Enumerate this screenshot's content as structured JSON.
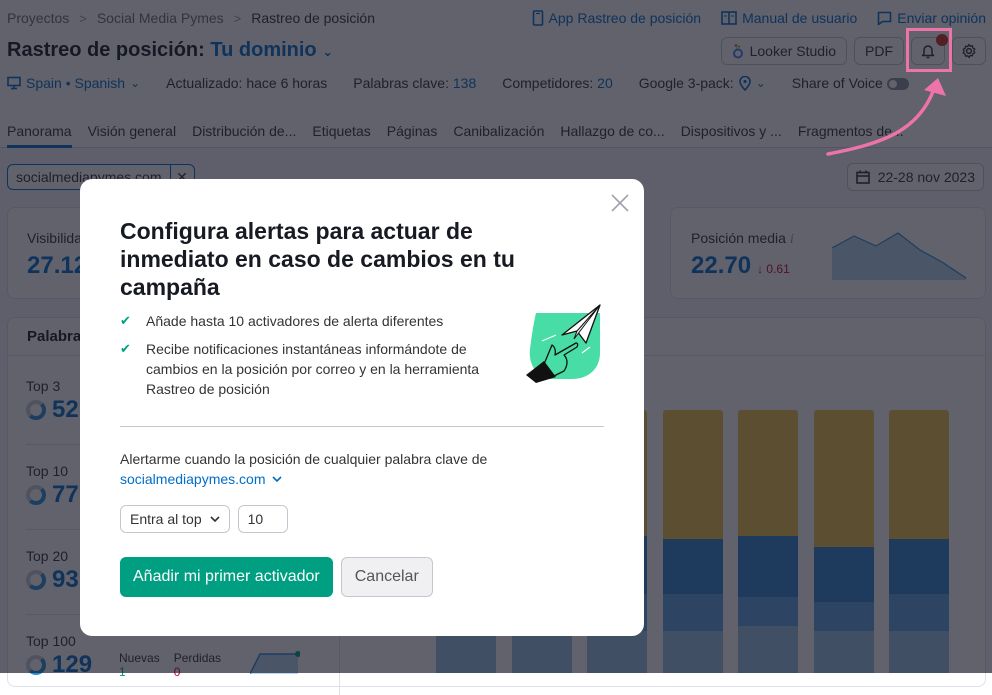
{
  "breadcrumb": [
    "Proyectos",
    "Social Media Pymes",
    "Rastreo de posición"
  ],
  "header_links": [
    {
      "label": "App Rastreo de posición",
      "icon": "mobile-icon"
    },
    {
      "label": "Manual de usuario",
      "icon": "book-icon"
    },
    {
      "label": "Enviar opinión",
      "icon": "comment-icon"
    }
  ],
  "title": {
    "prefix": "Rastreo de posición:",
    "domain": "Tu dominio"
  },
  "toolbar": {
    "looker_label": "Looker Studio",
    "pdf_label": "PDF",
    "bell_has_notification": true
  },
  "meta": {
    "location": "Spain • Spanish",
    "updated": "Actualizado: hace 6 horas",
    "keywords_label": "Palabras clave:",
    "keywords_value": "138",
    "competitors_label": "Competidores:",
    "competitors_value": "20",
    "google_pack_label": "Google 3-pack:",
    "share_of_voice_label": "Share of Voice",
    "share_of_voice_on": false
  },
  "tabs": [
    "Panorama",
    "Visión general",
    "Distribución de...",
    "Etiquetas",
    "Páginas",
    "Canibalización",
    "Hallazgo de co...",
    "Dispositivos y ...",
    "Fragmentos de..."
  ],
  "active_tab": "Panorama",
  "filter_chip": "socialmediapymes.com",
  "date_range": "22-28 nov 2023",
  "kpis": {
    "visibility": {
      "label": "Visibilidad",
      "value": "27.12"
    },
    "avg_position": {
      "label": "Posición media",
      "value": "22.70",
      "delta": "↓ 0.61"
    }
  },
  "keywords_card": {
    "title": "Palabras",
    "rows": [
      {
        "label": "Top 3",
        "value": "52"
      },
      {
        "label": "Top 10",
        "value": "77"
      },
      {
        "label": "Top 20",
        "value": "93"
      },
      {
        "label": "Top 100",
        "value": "129"
      }
    ],
    "new_label": "Nuevas",
    "new_value": "1",
    "lost_label": "Perdidas",
    "lost_value": "0"
  },
  "chart_data": {
    "type": "bar",
    "stacked": true,
    "series_colors": [
      "#9cc3ea",
      "#5fa4e0",
      "#2f86d4",
      "#f0c04a"
    ],
    "series": [
      {
        "name": "Top 100",
        "values": [
          0.16,
          0.16,
          0.16,
          0.16,
          0.18,
          0.16,
          0.16
        ]
      },
      {
        "name": "Top 20",
        "values": [
          0.14,
          0.14,
          0.14,
          0.14,
          0.11,
          0.11,
          0.14
        ]
      },
      {
        "name": "Top 10",
        "values": [
          0.22,
          0.22,
          0.22,
          0.21,
          0.23,
          0.21,
          0.21
        ]
      },
      {
        "name": "Top 3",
        "values": [
          0.48,
          0.48,
          0.48,
          0.49,
          0.48,
          0.52,
          0.49
        ]
      }
    ]
  },
  "modal": {
    "title": "Configura alertas para actuar de inmediato en caso de cambios en tu campaña",
    "bullets": [
      "Añade hasta 10 activadores de alerta diferentes",
      "Recibe notificaciones instantáneas informándote de cambios en la posición por correo y en la herramienta Rastreo de posición"
    ],
    "prompt": "Alertarme cuando la posición de cualquier palabra clave de",
    "domain": "socialmediapymes.com",
    "condition": "Entra al top",
    "threshold": "10",
    "primary_label": "Añadir mi primer activador",
    "cancel_label": "Cancelar"
  }
}
